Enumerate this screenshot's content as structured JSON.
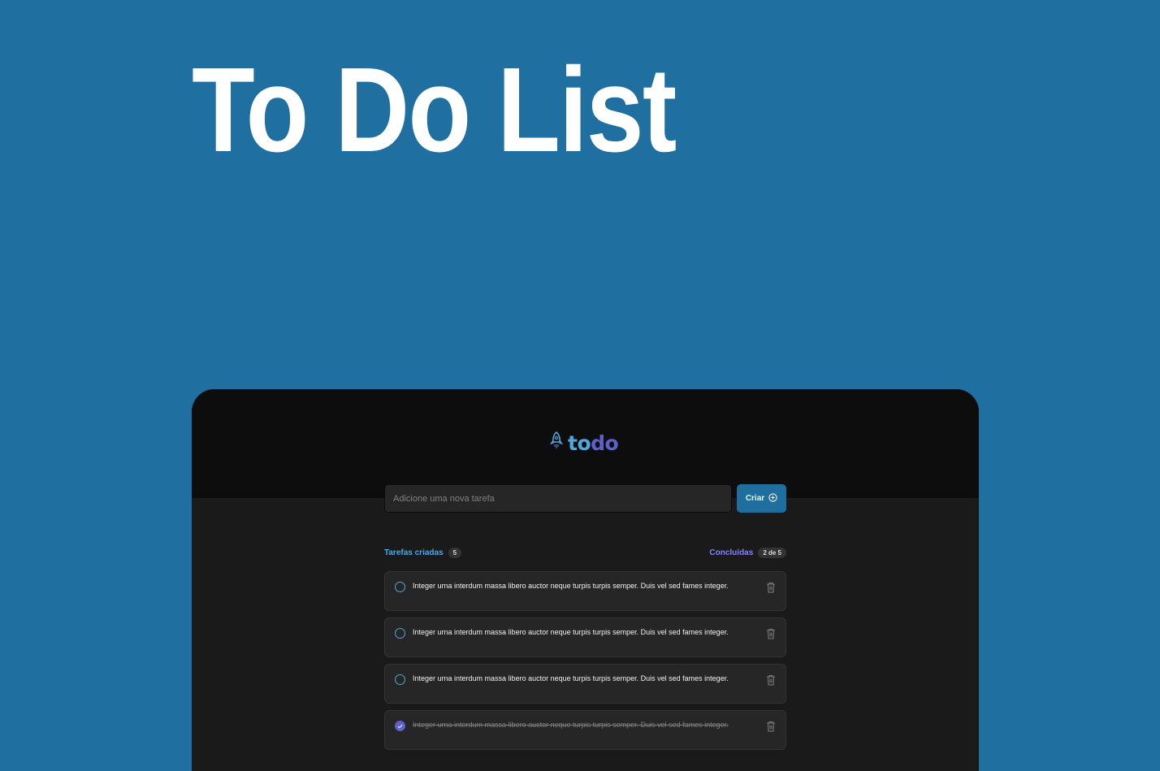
{
  "hero": {
    "title": "To Do List"
  },
  "app": {
    "logo": {
      "part1": "to",
      "part2": "do",
      "icon": "rocket-icon"
    },
    "input": {
      "placeholder": "Adicione uma nova tarefa",
      "value": ""
    },
    "create_button": {
      "label": "Criar",
      "icon": "plus-circle-icon"
    },
    "counters": {
      "created_label": "Tarefas criadas",
      "created_count": "5",
      "done_label": "Concluídas",
      "done_count": "2 de 5"
    },
    "tasks": [
      {
        "text": "Integer urna interdum massa libero auctor neque turpis turpis semper. Duis vel sed fames integer.",
        "done": false
      },
      {
        "text": "Integer urna interdum massa libero auctor neque turpis turpis semper. Duis vel sed fames integer.",
        "done": false
      },
      {
        "text": "Integer urna interdum massa libero auctor neque turpis turpis semper. Duis vel sed fames integer.",
        "done": false
      },
      {
        "text": "Integer urna interdum massa libero auctor neque turpis turpis semper. Duis vel sed fames integer.",
        "done": true
      }
    ]
  },
  "colors": {
    "background": "#1f6fa0",
    "accent_blue": "#4ea8de",
    "accent_purple": "#5e60ce",
    "button": "#1e6f9f"
  }
}
